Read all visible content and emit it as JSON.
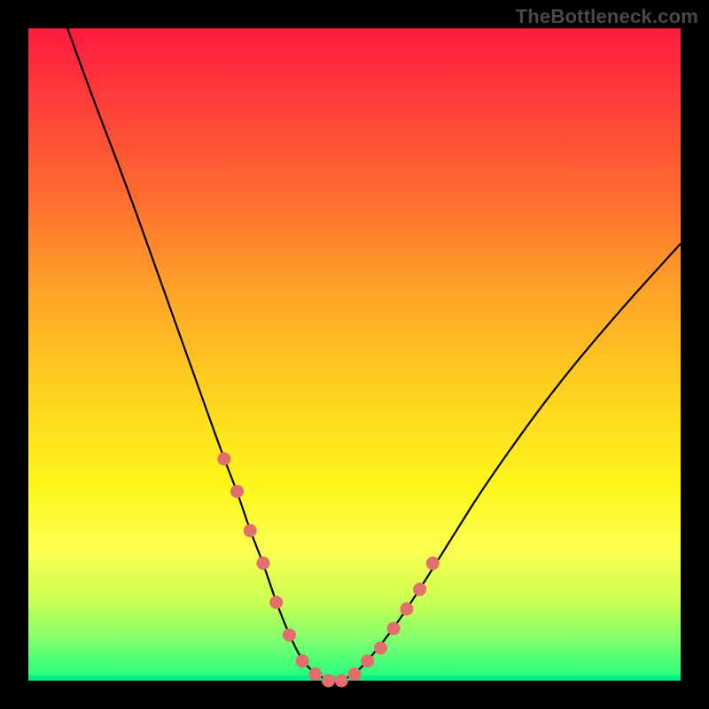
{
  "watermark": "TheBottleneck.com",
  "colors": {
    "frame": "#000000",
    "curve": "#000000",
    "marker_fill": "#e36e6e",
    "marker_stroke": "#a24a4a"
  },
  "chart_data": {
    "type": "line",
    "title": "",
    "xlabel": "",
    "ylabel": "",
    "xlim": [
      0,
      100
    ],
    "ylim": [
      0,
      100
    ],
    "grid": false,
    "series": [
      {
        "name": "bottleneck-curve",
        "x": [
          6,
          10,
          15,
          20,
          25,
          30,
          32,
          34,
          36,
          38,
          40,
          42,
          44,
          46,
          48,
          50,
          52,
          56,
          60,
          65,
          70,
          80,
          90,
          100
        ],
        "y": [
          100,
          89,
          76,
          62,
          48,
          34,
          29,
          23,
          18,
          12,
          7,
          3,
          1,
          0,
          0,
          1,
          3,
          8,
          14,
          22,
          30,
          44,
          56,
          67
        ]
      }
    ],
    "markers": {
      "name": "highlight-points",
      "x": [
        30,
        32,
        34,
        36,
        38,
        40,
        42,
        44,
        46,
        48,
        50,
        52,
        54,
        56,
        58,
        60,
        62
      ],
      "y": [
        34,
        29,
        23,
        18,
        12,
        7,
        3,
        1,
        0,
        0,
        1,
        3,
        5,
        8,
        11,
        14,
        18
      ]
    }
  }
}
